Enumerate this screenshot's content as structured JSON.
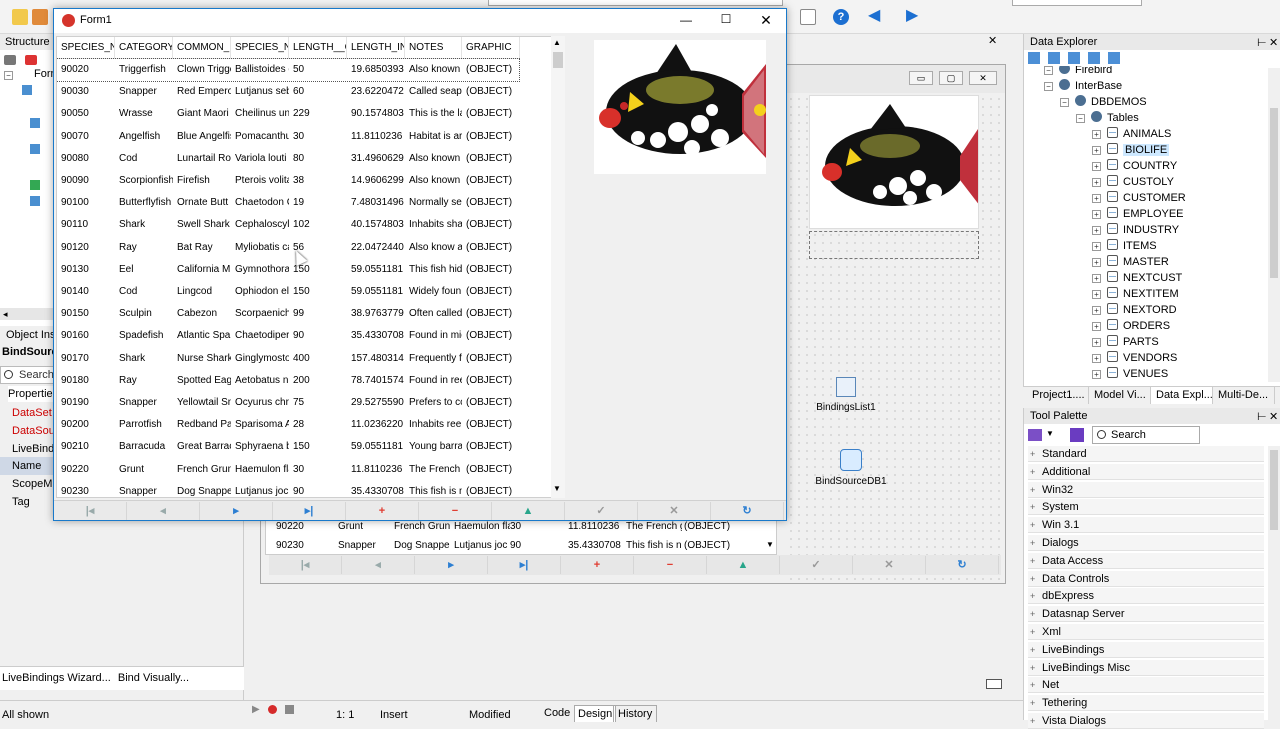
{
  "ide": {
    "structure_title": "Structure",
    "object_inspector_title": "Object Ins",
    "bind_source": "BindSourc",
    "search_placeholder": "Search",
    "properties_tab": "Propertie",
    "inspector_rows": [
      "DataSet",
      "DataSou",
      "LiveBind",
      "Name",
      "ScopeM",
      "Tag"
    ],
    "livebindings_wizard": "LiveBindings Wizard...",
    "bind_visually": "Bind Visually...",
    "all_shown": "All shown",
    "cursor_pos": "1:  1",
    "insert_mode": "Insert",
    "modified": "Modified",
    "tabs": [
      "Code",
      "Design",
      "History"
    ],
    "form_stub": "Forn"
  },
  "form1": {
    "title": "Form1",
    "columns": [
      "SPECIES_NO",
      "CATEGORY",
      "COMMON_N",
      "SPECIES_NA",
      "LENGTH__CI",
      "LENGTH_IN",
      "NOTES",
      "GRAPHIC"
    ],
    "rows": [
      [
        "90020",
        "Triggerfish",
        "Clown Trigge",
        "Ballistoides c",
        "50",
        "19.6850393",
        "Also known a",
        "(OBJECT)"
      ],
      [
        "90030",
        "Snapper",
        "Red Empero",
        "Lutjanus seb",
        "60",
        "23.6220472",
        "Called seape",
        "(OBJECT)"
      ],
      [
        "90050",
        "Wrasse",
        "Giant Maori W",
        "Cheilinus und",
        "229",
        "90.1574803",
        "This is the la",
        "(OBJECT)"
      ],
      [
        "90070",
        "Angelfish",
        "Blue Angelfis",
        "Pomacanthu",
        "30",
        "11.8110236",
        "Habitat is ar",
        "(OBJECT)"
      ],
      [
        "90080",
        "Cod",
        "Lunartail Ro",
        "Variola louti",
        "80",
        "31.4960629",
        "Also known a",
        "(OBJECT)"
      ],
      [
        "90090",
        "Scorpionfish",
        "Firefish",
        "Pterois volita",
        "38",
        "14.9606299",
        "Also known a",
        "(OBJECT)"
      ],
      [
        "90100",
        "Butterflyfish",
        "Ornate Butt",
        "Chaetodon C",
        "19",
        "7.48031496",
        "Normally see",
        "(OBJECT)"
      ],
      [
        "90110",
        "Shark",
        "Swell Shark",
        "Cephaloscyll",
        "102",
        "40.1574803",
        "Inhabits sha",
        "(OBJECT)"
      ],
      [
        "90120",
        "Ray",
        "Bat Ray",
        "Myliobatis ca",
        "56",
        "22.0472440",
        "Also know as",
        "(OBJECT)"
      ],
      [
        "90130",
        "Eel",
        "California M",
        "Gymnothora",
        "150",
        "59.0551181",
        "This fish hide",
        "(OBJECT)"
      ],
      [
        "90140",
        "Cod",
        "Lingcod",
        "Ophiodon ele",
        "150",
        "59.0551181",
        "Widely foun",
        "(OBJECT)"
      ],
      [
        "90150",
        "Sculpin",
        "Cabezon",
        "Scorpaenich",
        "99",
        "38.9763779",
        "Often called",
        "(OBJECT)"
      ],
      [
        "90160",
        "Spadefish",
        "Atlantic Spa",
        "Chaetodiper",
        "90",
        "35.4330708",
        "Found in mic",
        "(OBJECT)"
      ],
      [
        "90170",
        "Shark",
        "Nurse Shark",
        "Ginglymosto",
        "400",
        "157.480314",
        "Frequently f",
        "(OBJECT)"
      ],
      [
        "90180",
        "Ray",
        "Spotted Eag",
        "Aetobatus n",
        "200",
        "78.7401574",
        "Found in ree",
        "(OBJECT)"
      ],
      [
        "90190",
        "Snapper",
        "Yellowtail Sn",
        "Ocyurus chr",
        "75",
        "29.5275590",
        "Prefers to cc",
        "(OBJECT)"
      ],
      [
        "90200",
        "Parrotfish",
        "Redband Pa",
        "Sparisoma A",
        "28",
        "11.0236220",
        "Inhabits ree",
        "(OBJECT)"
      ],
      [
        "90210",
        "Barracuda",
        "Great Barrac",
        "Sphyraena b",
        "150",
        "59.0551181",
        "Young barra",
        "(OBJECT)"
      ],
      [
        "90220",
        "Grunt",
        "French Grun",
        "Haemulon fla",
        "30",
        "11.8110236",
        "The French g",
        "(OBJECT)"
      ],
      [
        "90230",
        "Snapper",
        "Dog Snappe",
        "Lutjanus joc",
        "90",
        "35.4330708",
        "This fish is n",
        "(OBJECT)"
      ]
    ],
    "nav_symbols": [
      "|◂",
      "◂",
      "▸",
      "▸|",
      "+",
      "−",
      "▲",
      "✓",
      "✕",
      "↻"
    ]
  },
  "designer": {
    "behind_rows": [
      [
        "90220",
        "Grunt",
        "French Grun",
        "Haemulon fla",
        "30",
        "11.8110236",
        "The French g",
        "(OBJECT)"
      ],
      [
        "90230",
        "Snapper",
        "Dog Snappe",
        "Lutjanus joc",
        "90",
        "35.4330708",
        "This fish is n",
        "(OBJECT)"
      ]
    ],
    "component1": "BindingsList1",
    "component2": "BindSourceDB1"
  },
  "data_explorer": {
    "title": "Data Explorer",
    "items": [
      {
        "label": "Firebird",
        "level": 1,
        "kind": "db"
      },
      {
        "label": "InterBase",
        "level": 1,
        "kind": "db"
      },
      {
        "label": "DBDEMOS",
        "level": 2,
        "kind": "conn"
      },
      {
        "label": "Tables",
        "level": 3,
        "kind": "folder"
      },
      {
        "label": "ANIMALS",
        "level": 4,
        "kind": "table"
      },
      {
        "label": "BIOLIFE",
        "level": 4,
        "kind": "table",
        "selected": true
      },
      {
        "label": "COUNTRY",
        "level": 4,
        "kind": "table"
      },
      {
        "label": "CUSTOLY",
        "level": 4,
        "kind": "table"
      },
      {
        "label": "CUSTOMER",
        "level": 4,
        "kind": "table"
      },
      {
        "label": "EMPLOYEE",
        "level": 4,
        "kind": "table"
      },
      {
        "label": "INDUSTRY",
        "level": 4,
        "kind": "table"
      },
      {
        "label": "ITEMS",
        "level": 4,
        "kind": "table"
      },
      {
        "label": "MASTER",
        "level": 4,
        "kind": "table"
      },
      {
        "label": "NEXTCUST",
        "level": 4,
        "kind": "table"
      },
      {
        "label": "NEXTITEM",
        "level": 4,
        "kind": "table"
      },
      {
        "label": "NEXTORD",
        "level": 4,
        "kind": "table"
      },
      {
        "label": "ORDERS",
        "level": 4,
        "kind": "table"
      },
      {
        "label": "PARTS",
        "level": 4,
        "kind": "table"
      },
      {
        "label": "VENDORS",
        "level": 4,
        "kind": "table"
      },
      {
        "label": "VENUES",
        "level": 4,
        "kind": "table"
      }
    ],
    "tabs": [
      "Project1....",
      "Model Vi...",
      "Data Expl...",
      "Multi-De..."
    ]
  },
  "tool_palette": {
    "title": "Tool Palette",
    "search_placeholder": "Search",
    "categories": [
      "Standard",
      "Additional",
      "Win32",
      "System",
      "Win 3.1",
      "Dialogs",
      "Data Access",
      "Data Controls",
      "dbExpress",
      "Datasnap Server",
      "Xml",
      "LiveBindings",
      "LiveBindings Misc",
      "Net",
      "Tethering",
      "Vista Dialogs"
    ]
  },
  "colors": {
    "accent": "#1979ca",
    "selected_row": "#cde8ff",
    "nav_blue": "#2d7fd2",
    "nav_red": "#e03a2f",
    "nav_green": "#28a58a"
  }
}
